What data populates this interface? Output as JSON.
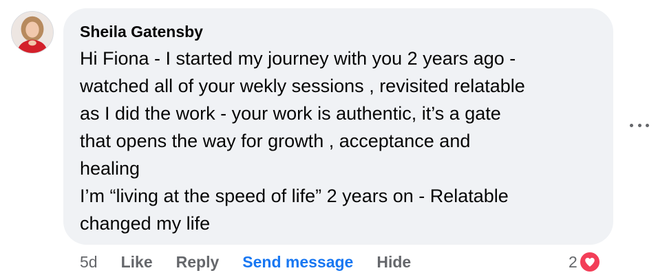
{
  "comment": {
    "author": "Sheila Gatensby",
    "text_lines": [
      "Hi Fiona - I started my journey with you 2 years ago -",
      "watched all of your wekly sessions , revisited relatable",
      "as I did the work - your work is authentic, it’s a gate",
      "that opens the way for growth , acceptance and",
      "healing",
      "I’m “living at the speed of life” 2 years on - Relatable",
      "changed my life"
    ]
  },
  "actions": {
    "time": "5d",
    "like": "Like",
    "reply": "Reply",
    "send_message": "Send message",
    "hide": "Hide"
  },
  "reactions": {
    "count": "2",
    "icon": "heart-icon",
    "color": "#f33e58"
  },
  "menu": {
    "icon": "more-options-icon"
  },
  "colors": {
    "bubble": "#f0f2f5",
    "text": "#050505",
    "secondary": "#65676b",
    "link": "#1877f2"
  }
}
